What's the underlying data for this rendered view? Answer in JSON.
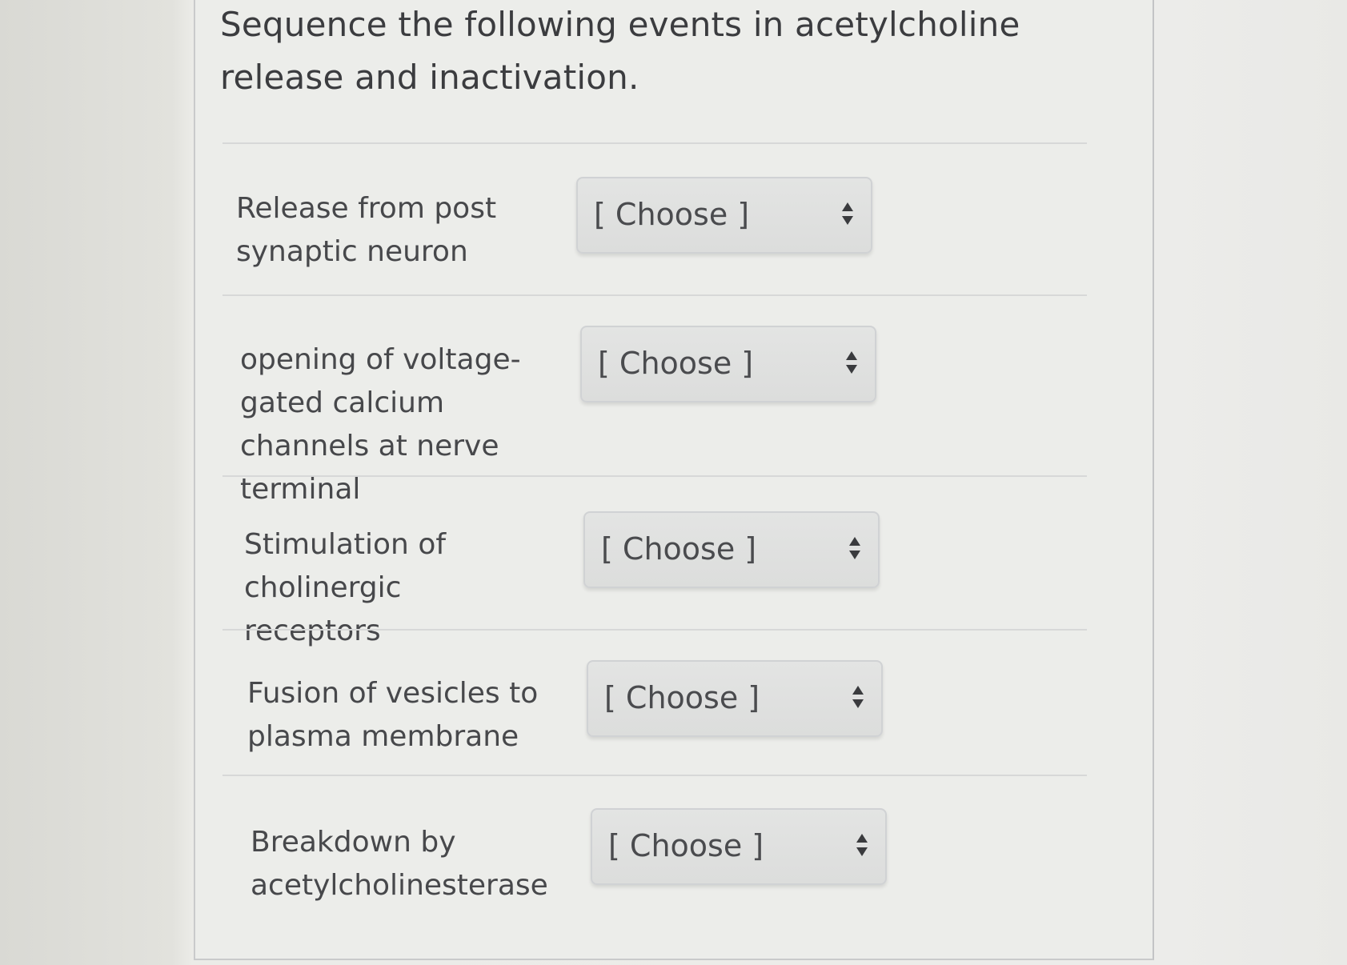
{
  "question": {
    "text": "Sequence the following events in acetylcholine release and inactivation."
  },
  "select_icon": "up-down-arrows-icon",
  "items": [
    {
      "label": "Release from post synaptic neuron",
      "selected": "[ Choose ]"
    },
    {
      "label": "opening of voltage-gated calcium channels at nerve terminal",
      "selected": "[ Choose ]"
    },
    {
      "label": "Stimulation of cholinergic receptors",
      "selected": "[ Choose ]"
    },
    {
      "label": "Fusion of vesicles to plasma membrane",
      "selected": "[ Choose ]"
    },
    {
      "label": "Breakdown by acetylcholinesterase",
      "selected": "[ Choose ]"
    }
  ]
}
